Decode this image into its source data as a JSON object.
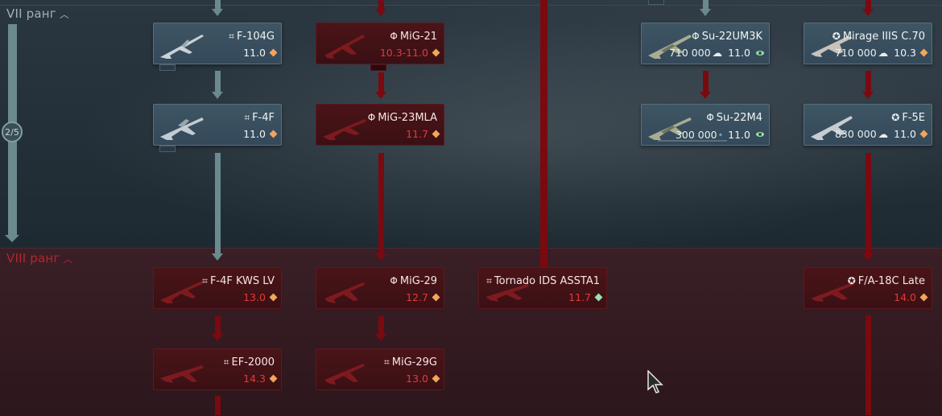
{
  "ranks": {
    "rank7": {
      "label": "VII ранг",
      "progress": "2/5"
    },
    "rank8": {
      "label": "VIII ранг"
    }
  },
  "cards": {
    "f104g": {
      "flag": "⌗",
      "name": "F-104G",
      "br": "11.0",
      "rp": "",
      "state": "researchable"
    },
    "f4f": {
      "flag": "⌗",
      "name": "F-4F",
      "br": "11.0",
      "rp": "",
      "state": "researchable"
    },
    "f4f_kws": {
      "flag": "⌗",
      "name": "F-4F KWS LV",
      "br": "13.0",
      "rp": "",
      "state": "locked"
    },
    "ef2000": {
      "flag": "⌗",
      "name": "EF-2000",
      "br": "14.3",
      "rp": "",
      "state": "locked"
    },
    "mig21": {
      "flag": "Φ",
      "name": "MiG-21",
      "br": "10.3-11.0",
      "rp": "",
      "state": "locked"
    },
    "mig23mla": {
      "flag": "Φ",
      "name": "MiG-23MLA",
      "br": "11.7",
      "rp": "",
      "state": "locked"
    },
    "mig29": {
      "flag": "Φ",
      "name": "MiG-29",
      "br": "12.7",
      "rp": "",
      "state": "locked"
    },
    "mig29g": {
      "flag": "⌗",
      "name": "MiG-29G",
      "br": "13.0",
      "rp": "",
      "state": "locked"
    },
    "tornado": {
      "flag": "⌗",
      "name": "Tornado IDS ASSTA1",
      "br": "11.7",
      "rp": "",
      "state": "locked"
    },
    "su22um3k": {
      "flag": "Φ",
      "name": "Su-22UM3K",
      "br": "11.0",
      "rp": "710 000",
      "state": "researchable"
    },
    "su22m4": {
      "flag": "Φ",
      "name": "Su-22M4",
      "br": "11.0",
      "rp": "300 000",
      "state": "researchable"
    },
    "mirage": {
      "flag": "✪",
      "name": "Mirage IIIS C.70",
      "br": "10.3",
      "rp": "710 000",
      "state": "researchable"
    },
    "f5e": {
      "flag": "✪",
      "name": "F-5E",
      "br": "11.0",
      "rp": "830 000",
      "state": "researchable"
    },
    "fa18c": {
      "flag": "✪",
      "name": "F/A-18C Late",
      "br": "14.0",
      "rp": "",
      "state": "locked"
    }
  },
  "colors": {
    "teal_line": "#6a8a8e",
    "red_line": "#7a0a10",
    "locked_br": "#e23a3a",
    "rank8_label": "#b0282e"
  },
  "icons": {
    "rp": "rp-icon",
    "br_diamond": "br-diamond-icon",
    "chevron": "chevron-up-icon"
  }
}
